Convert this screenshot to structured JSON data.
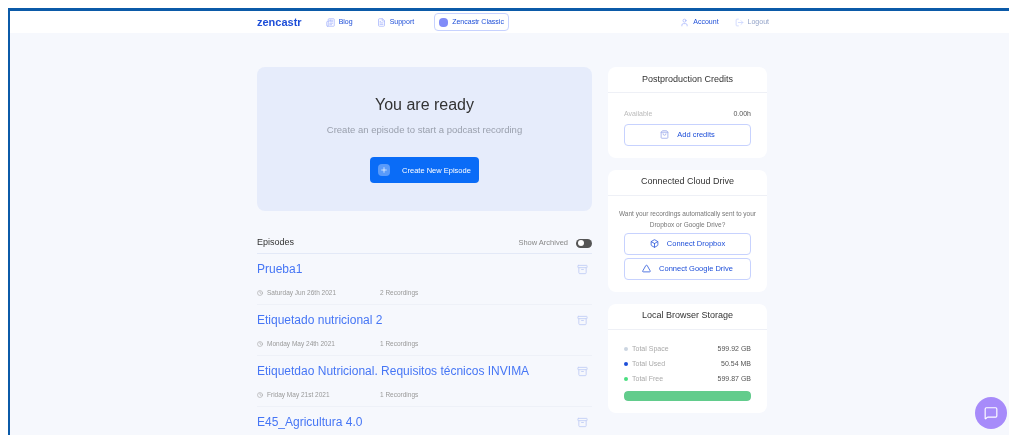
{
  "nav": {
    "logo": "zencastr",
    "links": [
      {
        "label": "Blog",
        "kind": "blog",
        "selected": false
      },
      {
        "label": "Support",
        "kind": "support",
        "selected": false
      },
      {
        "label": "Zencastr Classic",
        "kind": "classic",
        "selected": true
      }
    ],
    "account": "Account",
    "logout": "Logout"
  },
  "hero": {
    "title": "You are ready",
    "subtitle": "Create an episode to start a podcast recording",
    "button": "Create New Episode"
  },
  "episodes": {
    "title": "Episodes",
    "show_archived": {
      "label": "Show Archived",
      "on": false
    },
    "rows": [
      {
        "name": "Prueba1",
        "date": "Saturday Jun 26th 2021",
        "recordings": "2 Recordings"
      },
      {
        "name": "Etiquetado nutricional 2",
        "date": "Monday May 24th 2021",
        "recordings": "1 Recordings"
      },
      {
        "name": "Etiquetdao Nutricional. Requisitos técnicos INVIMA",
        "date": "Friday May 21st 2021",
        "recordings": "1 Recordings"
      },
      {
        "name": "E45_Agricultura 4.0"
      }
    ]
  },
  "credits": {
    "title": "Postproduction Credits",
    "available_label": "Available",
    "available_value": "0.00h",
    "button": "Add credits"
  },
  "cloud": {
    "title": "Connected Cloud Drive",
    "text": "Want your recordings automatically sent to your Dropbox or Google Drive?",
    "buttons": [
      {
        "label": "Connect Dropbox",
        "kind": "dropbox"
      },
      {
        "label": "Connect Google Drive",
        "kind": "gdrive"
      }
    ]
  },
  "storage": {
    "title": "Local Browser Storage",
    "items": [
      {
        "label": "Total Space",
        "value": "599.92 GB",
        "color": "#cbd5e1"
      },
      {
        "label": "Total Used",
        "value": "50.54 MB",
        "color": "#1d4ed8"
      },
      {
        "label": "Total Free",
        "value": "599.87 GB",
        "color": "#4ade80"
      }
    ],
    "level": 1
  }
}
